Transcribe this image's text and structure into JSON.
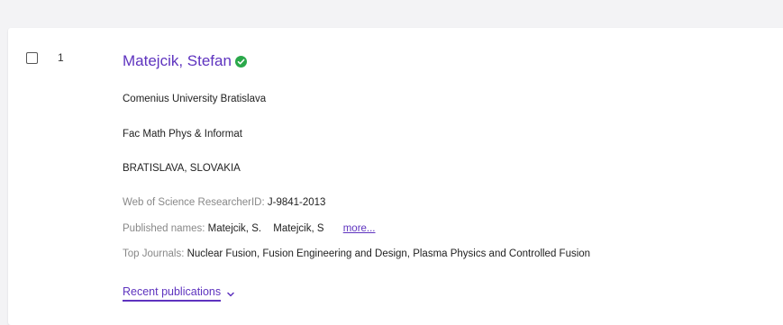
{
  "record": {
    "index": "1",
    "name": "Matejcik, Stefan",
    "verified_icon": "check-circle-icon",
    "institution": "Comenius University Bratislava",
    "department": "Fac Math Phys & Informat",
    "location": "BRATISLAVA, SLOVAKIA",
    "researcher_id_label": "Web of Science ResearcherID:",
    "researcher_id": "J-9841-2013",
    "published_names_label": "Published names:",
    "published_names": [
      "Matejcik, S.",
      "Matejcik, S"
    ],
    "more_label": "more...",
    "top_journals_label": "Top Journals:",
    "top_journals": "Nuclear Fusion, Fusion Engineering and Design, Plasma Physics and Controlled Fusion",
    "recent_publications_label": "Recent publications",
    "expand_icon": "chevron-down-icon"
  },
  "colors": {
    "accent": "#5e33bf",
    "verified": "#2aa84a",
    "page_bg": "#f3f3f5"
  }
}
